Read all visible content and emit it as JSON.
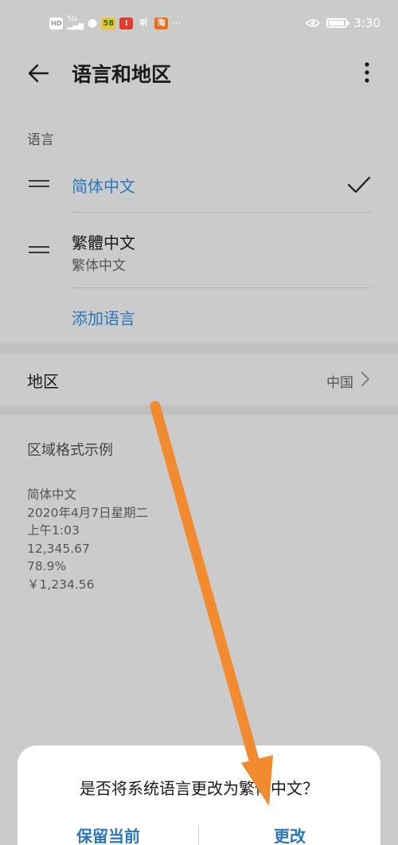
{
  "status_bar": {
    "left_icons": [
      "hd-icon",
      "5g-signal-icon",
      "wechat-icon",
      "58-app-icon",
      "notification-app-icon",
      "ting-app-icon",
      "taobao-app-icon",
      "more-dots-icon"
    ],
    "chip_58": "58",
    "chip_ting": "听",
    "chip_tao": "淘",
    "more": "···",
    "time": "3:30"
  },
  "toolbar": {
    "title": "语言和地区"
  },
  "language_section": {
    "label": "语言",
    "items": [
      {
        "name": "简体中文",
        "subtitle": "",
        "selected": true
      },
      {
        "name": "繁體中文",
        "subtitle": "繁体中文",
        "selected": false
      }
    ],
    "add_label": "添加语言"
  },
  "region": {
    "label": "地区",
    "value": "中国"
  },
  "format_example": {
    "title": "区域格式示例",
    "lines": [
      "简体中文",
      "2020年4月7日星期二",
      "上午1:03",
      "12,345.67",
      "78.9%",
      "￥1,234.56"
    ]
  },
  "dialog": {
    "message": "是否将系统语言更改为繁体中文？",
    "keep_label": "保留当前",
    "change_label": "更改"
  },
  "colors": {
    "accent": "#2a77bf",
    "background": "#cbcbcb",
    "annotation_arrow": "#f28a30"
  }
}
